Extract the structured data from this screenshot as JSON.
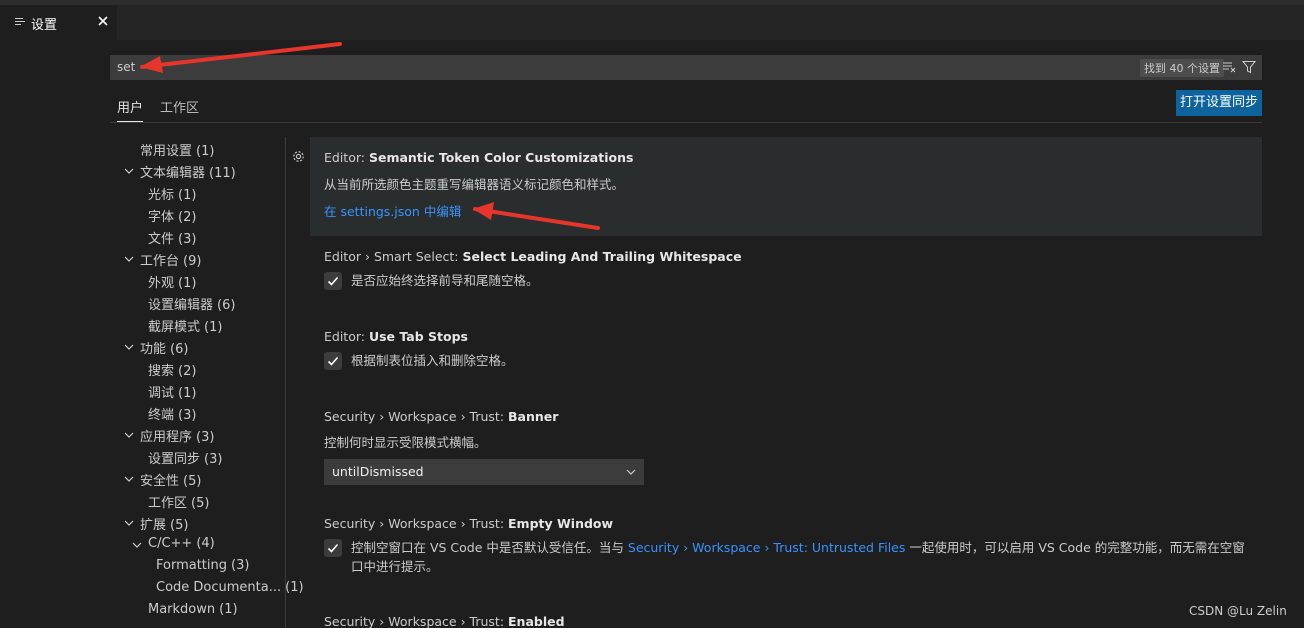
{
  "tab": {
    "title": "设置"
  },
  "search": {
    "value": "set",
    "result_count": "找到 40 个设置"
  },
  "scopes": {
    "user": "用户",
    "workspace": "工作区"
  },
  "sync_button": "打开设置同步",
  "toc": [
    {
      "label": "常用设置",
      "count": "(1)"
    },
    {
      "label": "文本编辑器",
      "count": "(11)"
    },
    {
      "label": "光标",
      "count": "(1)"
    },
    {
      "label": "字体",
      "count": "(2)"
    },
    {
      "label": "文件",
      "count": "(3)"
    },
    {
      "label": "工作台",
      "count": "(9)"
    },
    {
      "label": "外观",
      "count": "(1)"
    },
    {
      "label": "设置编辑器",
      "count": "(6)"
    },
    {
      "label": "截屏模式",
      "count": "(1)"
    },
    {
      "label": "功能",
      "count": "(6)"
    },
    {
      "label": "搜索",
      "count": "(2)"
    },
    {
      "label": "调试",
      "count": "(1)"
    },
    {
      "label": "终端",
      "count": "(3)"
    },
    {
      "label": "应用程序",
      "count": "(3)"
    },
    {
      "label": "设置同步",
      "count": "(3)"
    },
    {
      "label": "安全性",
      "count": "(5)"
    },
    {
      "label": "工作区",
      "count": "(5)"
    },
    {
      "label": "扩展",
      "count": "(5)"
    },
    {
      "label": "C/C++",
      "count": "(4)"
    },
    {
      "label": "Formatting",
      "count": "(3)"
    },
    {
      "label": "Code Documenta...",
      "count": "(1)"
    },
    {
      "label": "Markdown",
      "count": "(1)"
    }
  ],
  "settings": {
    "semantic": {
      "category": "Editor: ",
      "name": "Semantic Token Color Customizations",
      "description": "从当前所选颜色主题重写编辑器语义标记颜色和样式。",
      "link": "在 settings.json 中编辑"
    },
    "smart_select": {
      "category": "Editor › Smart Select: ",
      "name": "Select Leading And Trailing Whitespace",
      "description": "是否应始终选择前导和尾随空格。",
      "checked": true
    },
    "tab_stops": {
      "category": "Editor: ",
      "name": "Use Tab Stops",
      "description": "根据制表位插入和删除空格。",
      "checked": true
    },
    "trust_banner": {
      "category": "Security › Workspace › Trust: ",
      "name": "Banner",
      "description": "控制何时显示受限模式横幅。",
      "value": "untilDismissed"
    },
    "trust_empty": {
      "category": "Security › Workspace › Trust: ",
      "name": "Empty Window",
      "description_pre": "控制空窗口在 VS Code 中是否默认受信任。当与 ",
      "description_link": "Security › Workspace › Trust: Untrusted Files",
      "description_post": " 一起使用时，可以启用 VS Code 的完整功能，而无需在空窗口中进行提示。",
      "checked": true
    },
    "trust_enabled": {
      "category": "Security › Workspace › Trust: ",
      "name": "Enabled"
    }
  },
  "watermark": "CSDN @Lu Zelin",
  "colors": {
    "accent": "#0e639c",
    "link": "#3794ff",
    "annotation_arrow": "#e8352b"
  }
}
